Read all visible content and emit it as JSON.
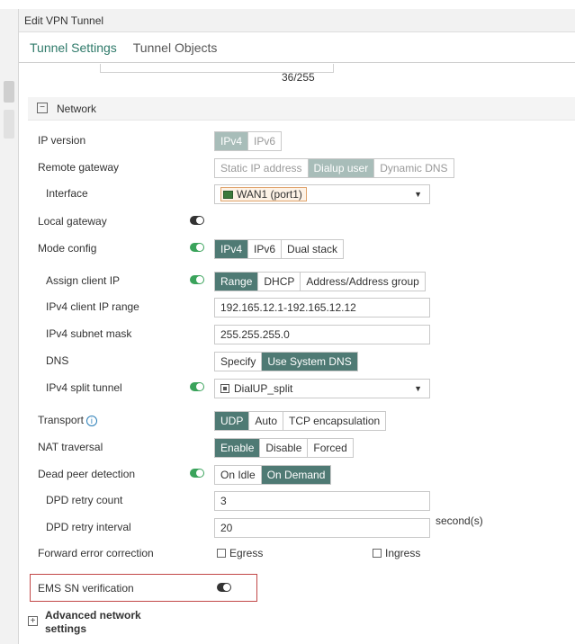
{
  "window": {
    "title": "Edit VPN Tunnel"
  },
  "tabs": [
    {
      "label": "Tunnel Settings"
    },
    {
      "label": "Tunnel Objects"
    }
  ],
  "counter": "36/255",
  "network": {
    "section_title": "Network",
    "ip_version": {
      "label": "IP version",
      "options": [
        "IPv4",
        "IPv6"
      ],
      "selected": "IPv4"
    },
    "remote_gateway": {
      "label": "Remote gateway",
      "options": [
        "Static IP address",
        "Dialup user",
        "Dynamic DNS"
      ],
      "selected": "Dialup user"
    },
    "interface": {
      "label": "Interface",
      "value": "WAN1 (port1)"
    },
    "local_gateway": {
      "label": "Local gateway",
      "enabled": false
    },
    "mode_config": {
      "label": "Mode config",
      "enabled": true,
      "options": [
        "IPv4",
        "IPv6",
        "Dual stack"
      ],
      "selected": "IPv4"
    },
    "assign_client_ip": {
      "label": "Assign client IP",
      "enabled": true,
      "options": [
        "Range",
        "DHCP",
        "Address/Address group"
      ],
      "selected": "Range"
    },
    "ipv4_client_ip_range": {
      "label": "IPv4 client IP range",
      "value": "192.165.12.1-192.165.12.12"
    },
    "ipv4_subnet_mask": {
      "label": "IPv4 subnet mask",
      "value": "255.255.255.0"
    },
    "dns": {
      "label": "DNS",
      "options": [
        "Specify",
        "Use System DNS"
      ],
      "selected": "Use System DNS"
    },
    "ipv4_split_tunnel": {
      "label": "IPv4 split tunnel",
      "enabled": true,
      "value": "DialUP_split"
    },
    "transport": {
      "label": "Transport",
      "options": [
        "UDP",
        "Auto",
        "TCP encapsulation"
      ],
      "selected": "UDP"
    },
    "nat_traversal": {
      "label": "NAT traversal",
      "options": [
        "Enable",
        "Disable",
        "Forced"
      ],
      "selected": "Enable"
    },
    "dead_peer_detection": {
      "label": "Dead peer detection",
      "enabled": true,
      "options": [
        "On Idle",
        "On Demand"
      ],
      "selected": "On Demand"
    },
    "dpd_retry_count": {
      "label": "DPD retry count",
      "value": "3"
    },
    "dpd_retry_interval": {
      "label": "DPD retry interval",
      "value": "20",
      "unit": "second(s)"
    },
    "forward_error_correction": {
      "label": "Forward error correction",
      "egress": "Egress",
      "ingress": "Ingress"
    },
    "ems_sn_verification": {
      "label": "EMS SN verification",
      "enabled": false
    },
    "advanced": {
      "label": "Advanced network settings"
    }
  }
}
